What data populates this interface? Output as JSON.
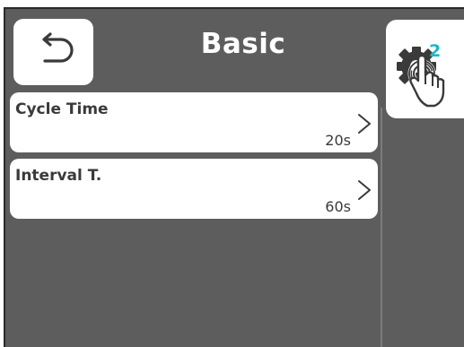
{
  "header": {
    "title": "Basic",
    "back_icon": "undo-arrow-icon",
    "settings_icon": "gear-touch-icon",
    "settings_badge": "2",
    "badge_color": "#19b8c6"
  },
  "items": [
    {
      "label": "Cycle Time",
      "value": "20s",
      "icon": "chevron-right-icon"
    },
    {
      "label": "Interval T.",
      "value": "60s",
      "icon": "chevron-right-icon"
    }
  ],
  "colors": {
    "background": "#5d5d5d",
    "card": "#ffffff",
    "text": "#3a3a3a"
  }
}
